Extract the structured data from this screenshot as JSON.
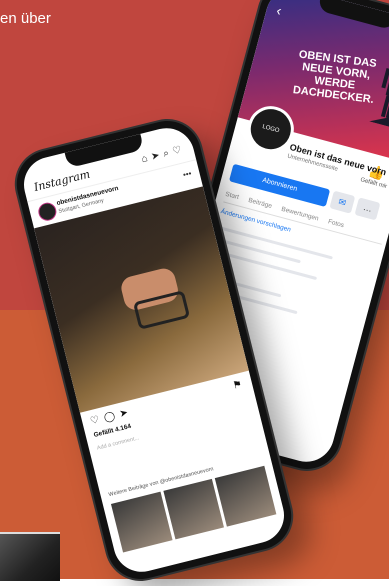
{
  "headline": "en über",
  "facebook": {
    "back": "‹",
    "cover_text": "OBEN IST DAS NEUE VORN, WERDE DACHDECKER.",
    "page_name": "Oben ist das neue vorn",
    "page_sub": "Unternehmensseite",
    "like_label": "Gefällt mir",
    "subscribe_button": "Abonnieren",
    "tabs": [
      "Start",
      "Beiträge",
      "Bewertungen",
      "Fotos"
    ],
    "link": "Änderungen vorschlagen"
  },
  "instagram": {
    "logo": "Instagram",
    "username": "obenistdasneuevorn",
    "location": "Stuttgart, Germany",
    "likes": "Gefällt 4.164",
    "comment_placeholder": "Add a comment...",
    "more_posts": "Weitere Beiträge von @obenistdasneuevorn"
  }
}
